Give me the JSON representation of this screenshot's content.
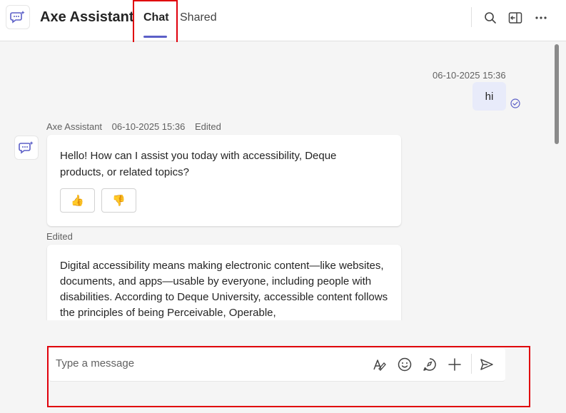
{
  "header": {
    "title": "Axe Assistant",
    "tabs": [
      {
        "label": "Chat",
        "active": true
      },
      {
        "label": "Shared",
        "active": false
      }
    ],
    "icons": [
      "search-icon",
      "popout-icon",
      "more-icon"
    ]
  },
  "messages": {
    "outgoing": {
      "timestamp": "06-10-2025 15:36",
      "text": "hi",
      "status_icon": "read-check-icon"
    },
    "incoming": [
      {
        "sender": "Axe Assistant",
        "timestamp": "06-10-2025 15:36",
        "edited": "Edited",
        "text": "Hello! How can I assist you today with accessibility, Deque products, or related topics?",
        "reactions": [
          "thumbs-up-icon",
          "thumbs-down-icon"
        ],
        "reaction_glyphs": [
          "👍",
          "👎"
        ]
      },
      {
        "edited": "Edited",
        "text": "Digital accessibility means making electronic content—like websites, documents, and apps—usable by everyone, including people with disabilities. According to Deque University, accessible content follows the principles of being Perceivable, Operable,"
      }
    ]
  },
  "compose": {
    "placeholder": "Type a message",
    "tools": [
      "format-icon",
      "emoji-icon",
      "loop-icon",
      "add-icon",
      "send-icon"
    ]
  },
  "colors": {
    "accent": "#5b5fc7",
    "highlight": "#e0000b",
    "outgoing_bubble": "#e8ebfa",
    "background": "#f5f5f5"
  }
}
